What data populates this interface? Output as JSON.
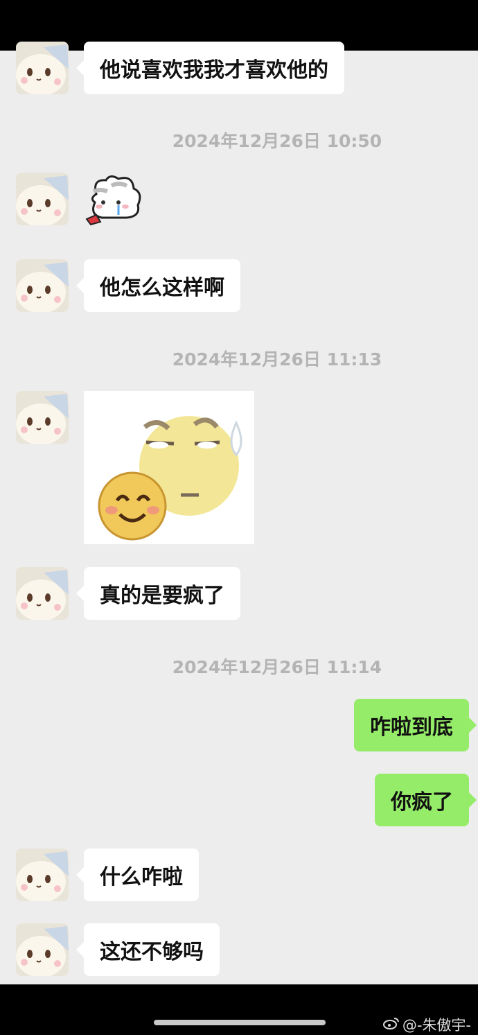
{
  "messages": [
    {
      "type": "text",
      "side": "left",
      "text": "他说喜欢我我才喜欢他的"
    },
    {
      "type": "time",
      "text": "2024年12月26日 10:50"
    },
    {
      "type": "sticker",
      "side": "left",
      "name": "crying-bunny-sticker"
    },
    {
      "type": "text",
      "side": "left",
      "text": "他怎么这样啊"
    },
    {
      "type": "time",
      "text": "2024年12月26日 11:13"
    },
    {
      "type": "sticker",
      "side": "left",
      "name": "emoji-faces-sticker"
    },
    {
      "type": "text",
      "side": "left",
      "text": "真的是要疯了"
    },
    {
      "type": "time",
      "text": "2024年12月26日 11:14"
    },
    {
      "type": "text",
      "side": "right",
      "text": "咋啦到底"
    },
    {
      "type": "text",
      "side": "right",
      "text": "你疯了"
    },
    {
      "type": "text",
      "side": "left",
      "text": "什么咋啦"
    },
    {
      "type": "text",
      "side": "left",
      "text": "这还不够吗"
    }
  ],
  "watermark": {
    "text": "@-朱傲宇-",
    "icon": "weibo-icon"
  },
  "colors": {
    "background": "#ededed",
    "bubble_left": "#ffffff",
    "bubble_right": "#95ec69",
    "timestamp": "#b4b4b4"
  }
}
